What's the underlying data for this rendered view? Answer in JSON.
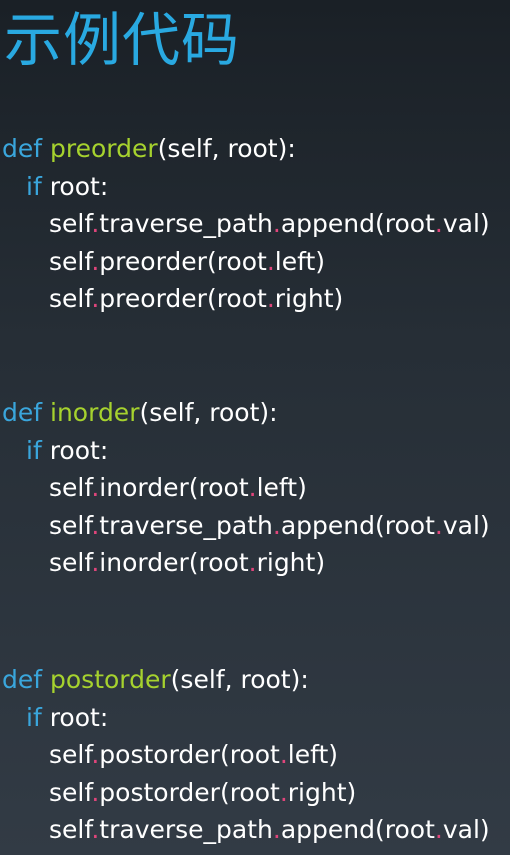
{
  "title": "示例代码",
  "colors": {
    "background": "#262e36",
    "title": "#29a9e1",
    "keyword": "#3aa6dc",
    "function_name": "#a6d22e",
    "dot": "#e0457b",
    "text": "#ffffff"
  },
  "blocks": [
    {
      "def_kw": "def",
      "func_name": "preorder",
      "params": "(self, root):",
      "if_kw": "if",
      "if_cond": "root:",
      "body": [
        [
          {
            "t": "self",
            "k": "t"
          },
          {
            "t": ".",
            "k": "dot"
          },
          {
            "t": "traverse_path",
            "k": "t"
          },
          {
            "t": ".",
            "k": "dot"
          },
          {
            "t": "append(root",
            "k": "t"
          },
          {
            "t": ".",
            "k": "dot"
          },
          {
            "t": "val)",
            "k": "t"
          }
        ],
        [
          {
            "t": "self",
            "k": "t"
          },
          {
            "t": ".",
            "k": "dot"
          },
          {
            "t": "preorder(root",
            "k": "t"
          },
          {
            "t": ".",
            "k": "dot"
          },
          {
            "t": "left)",
            "k": "t"
          }
        ],
        [
          {
            "t": "self",
            "k": "t"
          },
          {
            "t": ".",
            "k": "dot"
          },
          {
            "t": "preorder(root",
            "k": "t"
          },
          {
            "t": ".",
            "k": "dot"
          },
          {
            "t": "right)",
            "k": "t"
          }
        ]
      ]
    },
    {
      "def_kw": "def",
      "func_name": "inorder",
      "params": "(self, root):",
      "if_kw": "if",
      "if_cond": "root:",
      "body": [
        [
          {
            "t": "self",
            "k": "t"
          },
          {
            "t": ".",
            "k": "dot"
          },
          {
            "t": "inorder(root",
            "k": "t"
          },
          {
            "t": ".",
            "k": "dot"
          },
          {
            "t": "left)",
            "k": "t"
          }
        ],
        [
          {
            "t": "self",
            "k": "t"
          },
          {
            "t": ".",
            "k": "dot"
          },
          {
            "t": "traverse_path",
            "k": "t"
          },
          {
            "t": ".",
            "k": "dot"
          },
          {
            "t": "append(root",
            "k": "t"
          },
          {
            "t": ".",
            "k": "dot"
          },
          {
            "t": "val)",
            "k": "t"
          }
        ],
        [
          {
            "t": "self",
            "k": "t"
          },
          {
            "t": ".",
            "k": "dot"
          },
          {
            "t": "inorder(root",
            "k": "t"
          },
          {
            "t": ".",
            "k": "dot"
          },
          {
            "t": "right)",
            "k": "t"
          }
        ]
      ]
    },
    {
      "def_kw": "def",
      "func_name": "postorder",
      "params": "(self, root):",
      "if_kw": "if",
      "if_cond": "root:",
      "body": [
        [
          {
            "t": "self",
            "k": "t"
          },
          {
            "t": ".",
            "k": "dot"
          },
          {
            "t": "postorder(root",
            "k": "t"
          },
          {
            "t": ".",
            "k": "dot"
          },
          {
            "t": "left)",
            "k": "t"
          }
        ],
        [
          {
            "t": "self",
            "k": "t"
          },
          {
            "t": ".",
            "k": "dot"
          },
          {
            "t": "postorder(root",
            "k": "t"
          },
          {
            "t": ".",
            "k": "dot"
          },
          {
            "t": "right)",
            "k": "t"
          }
        ],
        [
          {
            "t": "self",
            "k": "t"
          },
          {
            "t": ".",
            "k": "dot"
          },
          {
            "t": "traverse_path",
            "k": "t"
          },
          {
            "t": ".",
            "k": "dot"
          },
          {
            "t": "append(root",
            "k": "t"
          },
          {
            "t": ".",
            "k": "dot"
          },
          {
            "t": "val)",
            "k": "t"
          }
        ]
      ]
    }
  ]
}
